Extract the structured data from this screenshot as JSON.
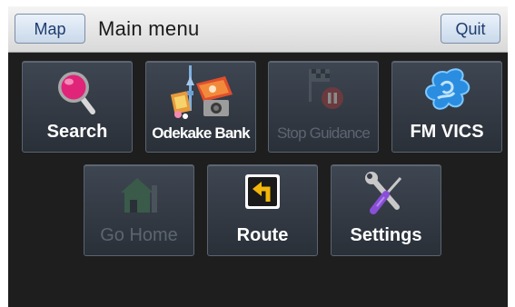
{
  "header": {
    "map_label": "Map",
    "title": "Main menu",
    "quit_label": "Quit"
  },
  "menu": {
    "search": {
      "label": "Search",
      "icon": "magnifier-icon",
      "enabled": true
    },
    "odekake_bank": {
      "label": "Odekake Bank",
      "icon": "odekake-bank-icon",
      "enabled": true
    },
    "stop_guidance": {
      "label": "Stop Guidance",
      "icon": "stop-guidance-icon",
      "enabled": false
    },
    "fm_vics": {
      "label": "FM VICS",
      "icon": "fm-vics-icon",
      "enabled": true
    },
    "go_home": {
      "label": "Go Home",
      "icon": "home-icon",
      "enabled": false
    },
    "route": {
      "label": "Route",
      "icon": "route-arrow-icon",
      "enabled": true
    },
    "settings": {
      "label": "Settings",
      "icon": "wrench-screwdriver-icon",
      "enabled": true
    }
  },
  "colors": {
    "background": "#1e1e1e",
    "tile": "#353c46",
    "header": "#e4e4e4",
    "accent_blue": "#1e3c6e"
  }
}
